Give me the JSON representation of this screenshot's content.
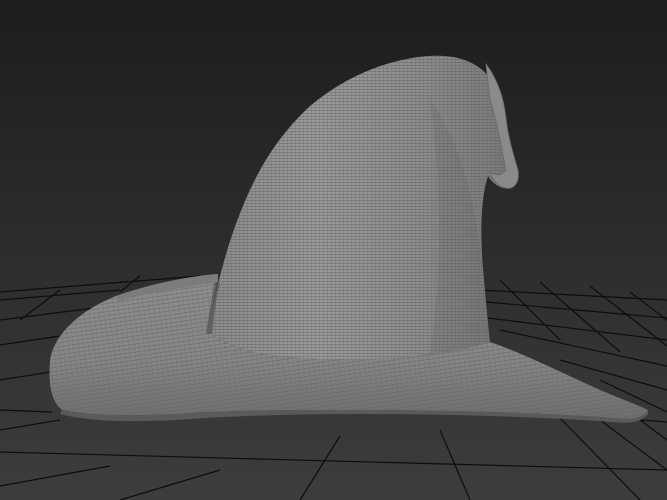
{
  "viewport": {
    "background_top": "#1f1f1f",
    "background_bottom": "#3b3b3b",
    "grid_color": "#0c0c0c",
    "grid_highlight": "#151515"
  },
  "model": {
    "object": "wizard-hat-mesh",
    "display_mode": "wireframe-on-shaded",
    "surface_color": "#8e8e8e",
    "wire_color": "#5f5f5f",
    "highlight_color": "#a6a6a6",
    "shadow_color": "#6d6d6d"
  }
}
